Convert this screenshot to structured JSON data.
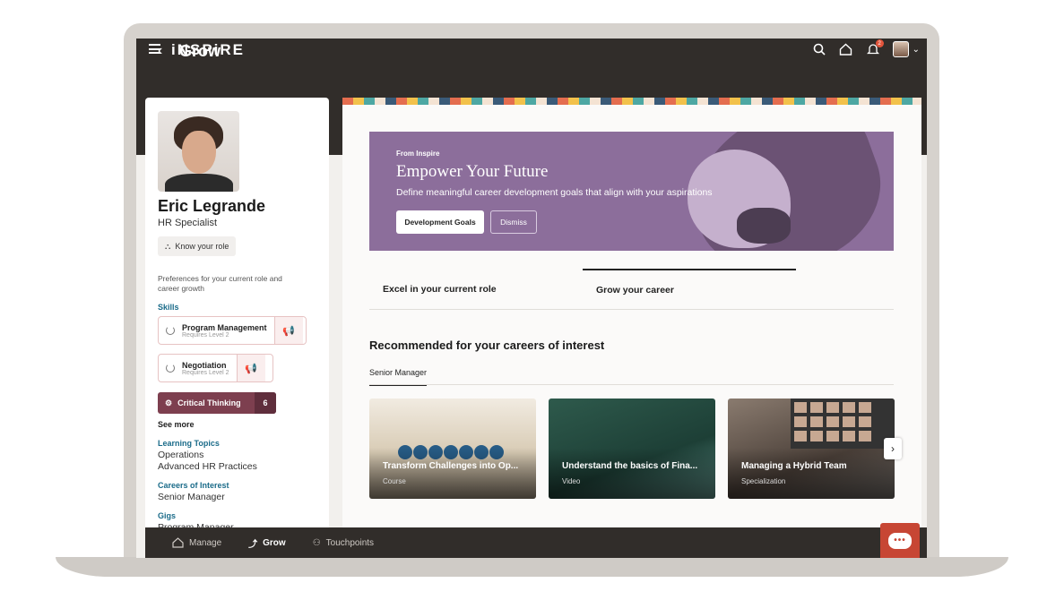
{
  "app": {
    "logo": "iNSPiRE",
    "notifications_badge": "2"
  },
  "header": {
    "back_icon": "chevron-left-icon",
    "title": "Grow"
  },
  "profile": {
    "name": "Eric Legrande",
    "role": "HR Specialist",
    "know_role_label": "Know your role",
    "preferences_text": "Preferences for your current role and career growth",
    "skills_label": "Skills",
    "skills": [
      {
        "name": "Program Management",
        "requirement": "Requires Level 2"
      },
      {
        "name": "Negotiation",
        "requirement": "Requires Level 2"
      }
    ],
    "highlight_skill": {
      "name": "Critical Thinking",
      "count": "6"
    },
    "see_more": "See more",
    "learning_topics_label": "Learning Topics",
    "learning_topics": [
      "Operations",
      "Advanced HR Practices"
    ],
    "careers_label": "Careers of Interest",
    "careers": [
      "Senior Manager"
    ],
    "gigs_label": "Gigs",
    "gigs": [
      "Program Manager"
    ]
  },
  "hero": {
    "eyebrow": "From Inspire",
    "title": "Empower Your Future",
    "description": "Define meaningful career development goals that align with your aspirations",
    "primary_button": "Development Goals",
    "secondary_button": "Dismiss"
  },
  "tabs": [
    {
      "label": "Excel in your current role"
    },
    {
      "label": "Grow your career"
    }
  ],
  "recommended": {
    "title": "Recommended for your careers of interest",
    "subtab": "Senior Manager",
    "cards": [
      {
        "title": "Transform Challenges into Op...",
        "type": "Course"
      },
      {
        "title": "Understand the basics of Fina...",
        "type": "Video"
      },
      {
        "title": "Managing a Hybrid Team",
        "type": "Specialization"
      }
    ]
  },
  "bottom_nav": [
    {
      "label": "Manage",
      "icon": "home-icon"
    },
    {
      "label": "Grow",
      "icon": "growth-icon"
    },
    {
      "label": "Touchpoints",
      "icon": "touchpoints-icon"
    }
  ],
  "colors": {
    "header": "#312d2a",
    "hero": "#8c6e9b",
    "accent_link": "#1a6b89",
    "skill_dark": "#7d3f4f",
    "chat": "#c74634"
  }
}
